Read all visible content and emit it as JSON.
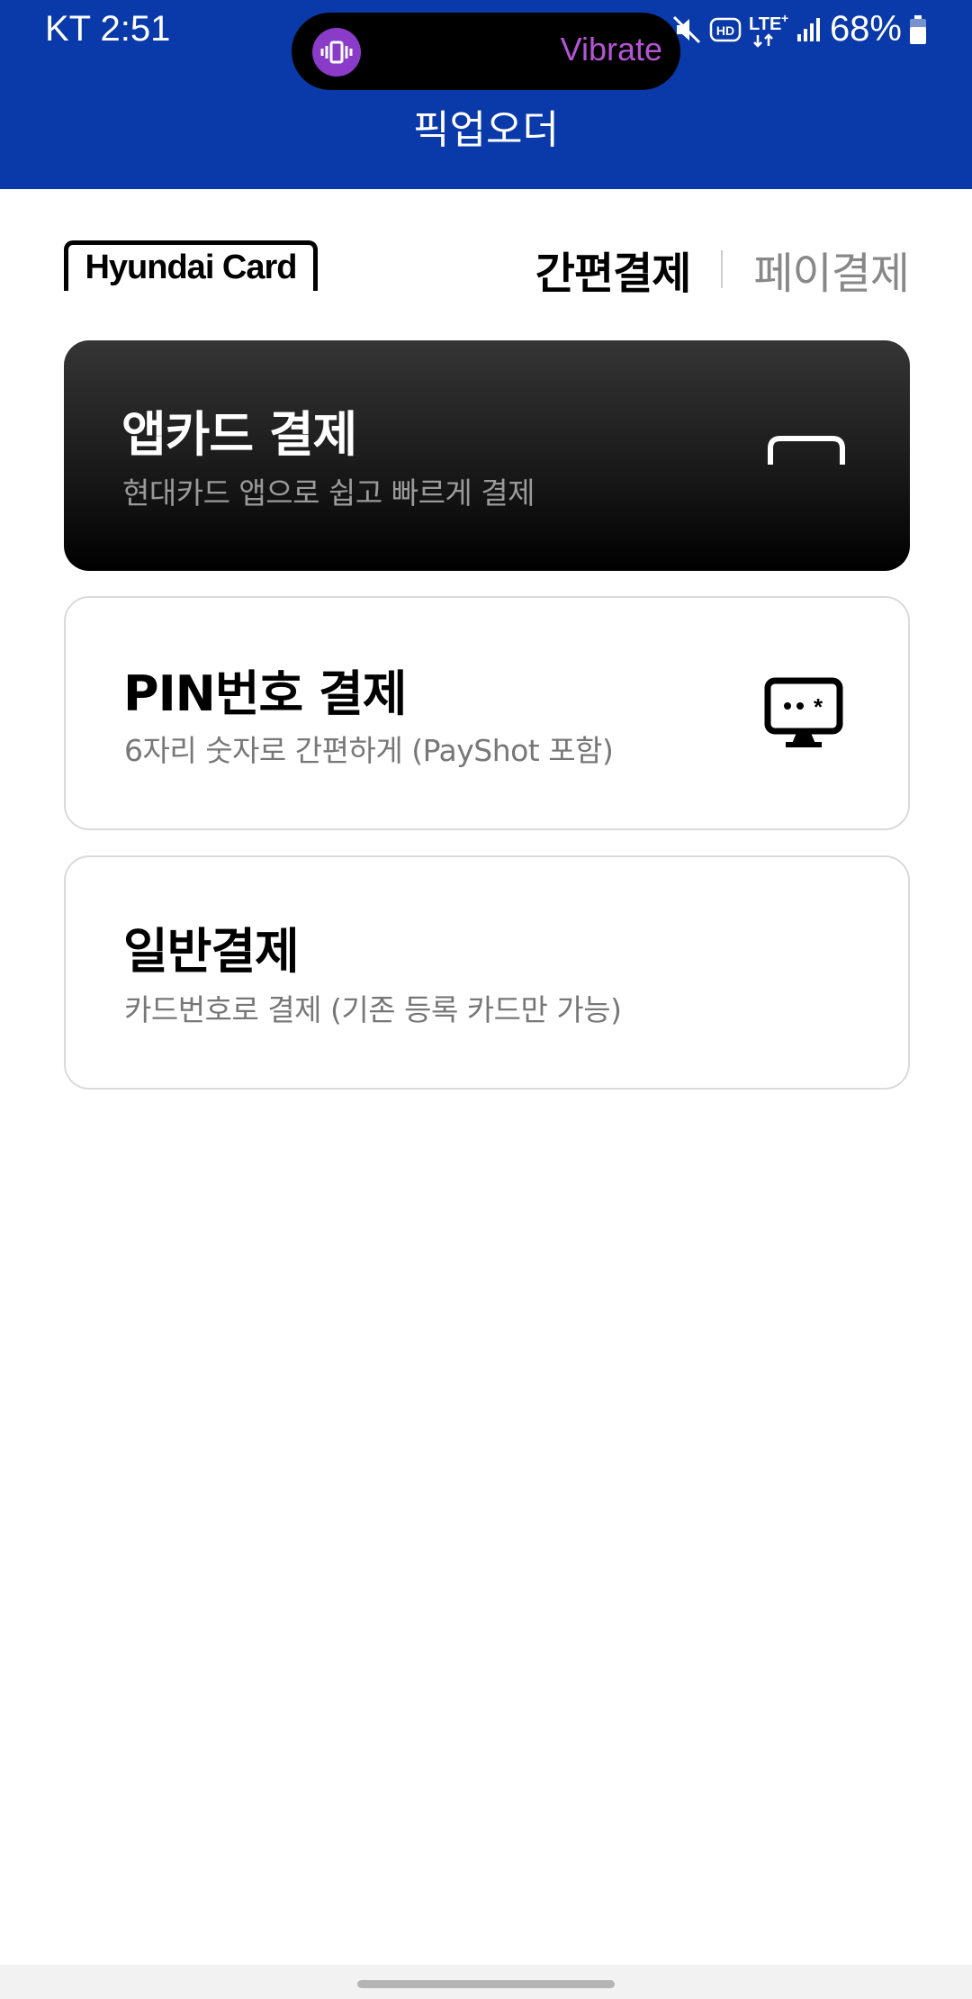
{
  "status_bar": {
    "time": "KT 2:51",
    "vibrate_label": "Vibrate",
    "battery": "68%",
    "icons": [
      "vibrate-icon",
      "mute-icon",
      "hd-icon",
      "lte-icon",
      "signal-icon",
      "battery-icon"
    ]
  },
  "header": {
    "title": "픽업오더",
    "color": "#0a3aa9"
  },
  "brand": {
    "logo_text": "Hyundai Card"
  },
  "tabs": {
    "items": [
      {
        "label": "간편결제",
        "active": true
      },
      {
        "label": "페이결제",
        "active": false
      }
    ]
  },
  "payment_options": [
    {
      "title": "앱카드 결제",
      "subtitle": "현대카드 앱으로 쉽고 빠르게 결제",
      "icon": "app-card-icon"
    },
    {
      "title": "PIN번호 결제",
      "subtitle": "6자리 숫자로 간편하게 (PayShot 포함)",
      "icon": "pin-monitor-icon"
    },
    {
      "title": "일반결제",
      "subtitle": "카드번호로 결제 (기존 등록 카드만 가능)",
      "icon": ""
    }
  ]
}
